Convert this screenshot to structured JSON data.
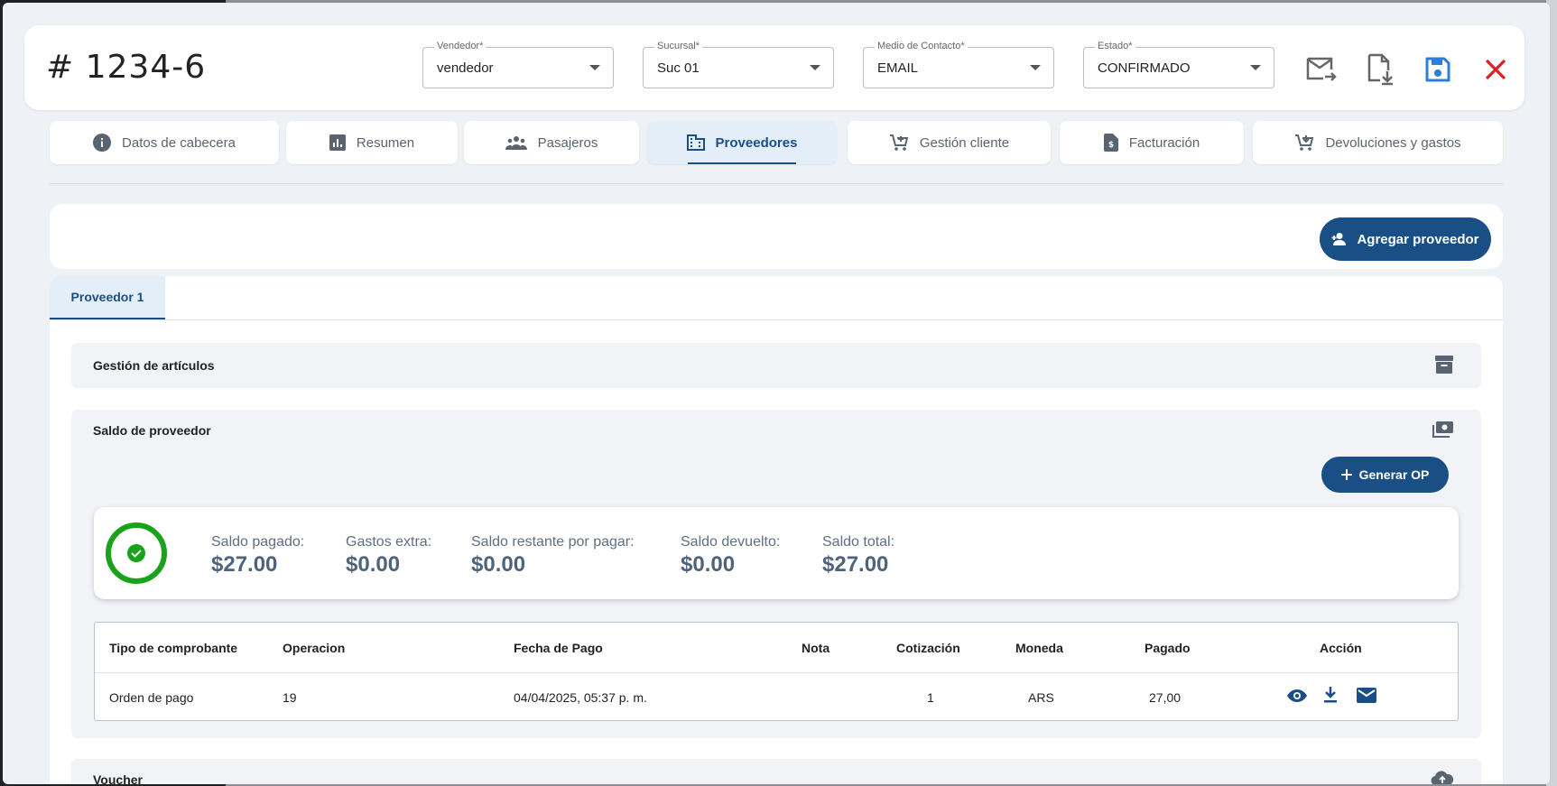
{
  "header": {
    "title": "# 1234-6",
    "selects": [
      {
        "label": "Vendedor*",
        "value": "vendedor"
      },
      {
        "label": "Sucursal*",
        "value": "Suc 01"
      },
      {
        "label": "Medio de Contacto*",
        "value": "EMAIL"
      },
      {
        "label": "Estado*",
        "value": "CONFIRMADO"
      }
    ],
    "icons": [
      "send-email-icon",
      "download-file-icon",
      "save-icon",
      "close-icon"
    ]
  },
  "tabs": [
    {
      "label": "Datos de cabecera",
      "icon": "info-icon"
    },
    {
      "label": "Resumen",
      "icon": "chart-icon"
    },
    {
      "label": "Pasajeros",
      "icon": "group-icon"
    },
    {
      "label": "Proveedores",
      "icon": "building-icon",
      "active": true
    },
    {
      "label": "Gestión cliente",
      "icon": "cart-add-icon"
    },
    {
      "label": "Facturación",
      "icon": "invoice-icon"
    },
    {
      "label": "Devoluciones y gastos",
      "icon": "cart-return-icon"
    }
  ],
  "top_card": {
    "add_provider_label": "Agregar proveedor"
  },
  "provider_tab": {
    "label": "Proveedor 1"
  },
  "sections": {
    "articles": {
      "title": "Gestión de artículos"
    },
    "balance": {
      "title": "Saldo de proveedor",
      "generate_op_label": "Generar OP"
    },
    "voucher": {
      "title": "Voucher"
    }
  },
  "summary": {
    "paid": {
      "label": "Saldo pagado:",
      "value": "$27.00"
    },
    "extra": {
      "label": "Gastos extra:",
      "value": "$0.00"
    },
    "remaining": {
      "label": "Saldo restante por pagar:",
      "value": "$0.00"
    },
    "returned": {
      "label": "Saldo devuelto:",
      "value": "$0.00"
    },
    "total": {
      "label": "Saldo total:",
      "value": "$27.00"
    }
  },
  "table": {
    "headers": [
      "Tipo de comprobante",
      "Operacion",
      "Fecha de Pago",
      "Nota",
      "Cotización",
      "Moneda",
      "Pagado",
      "Acción"
    ],
    "rows": [
      {
        "tipo": "Orden de pago",
        "operacion": "19",
        "fecha": "04/04/2025, 05:37 p. m.",
        "nota": "",
        "cotizacion": "1",
        "moneda": "ARS",
        "pagado": "27,00"
      }
    ]
  },
  "colors": {
    "primary": "#1a4f86",
    "success": "#1aa31a",
    "danger": "#e02020",
    "save": "#2b7fd8"
  }
}
